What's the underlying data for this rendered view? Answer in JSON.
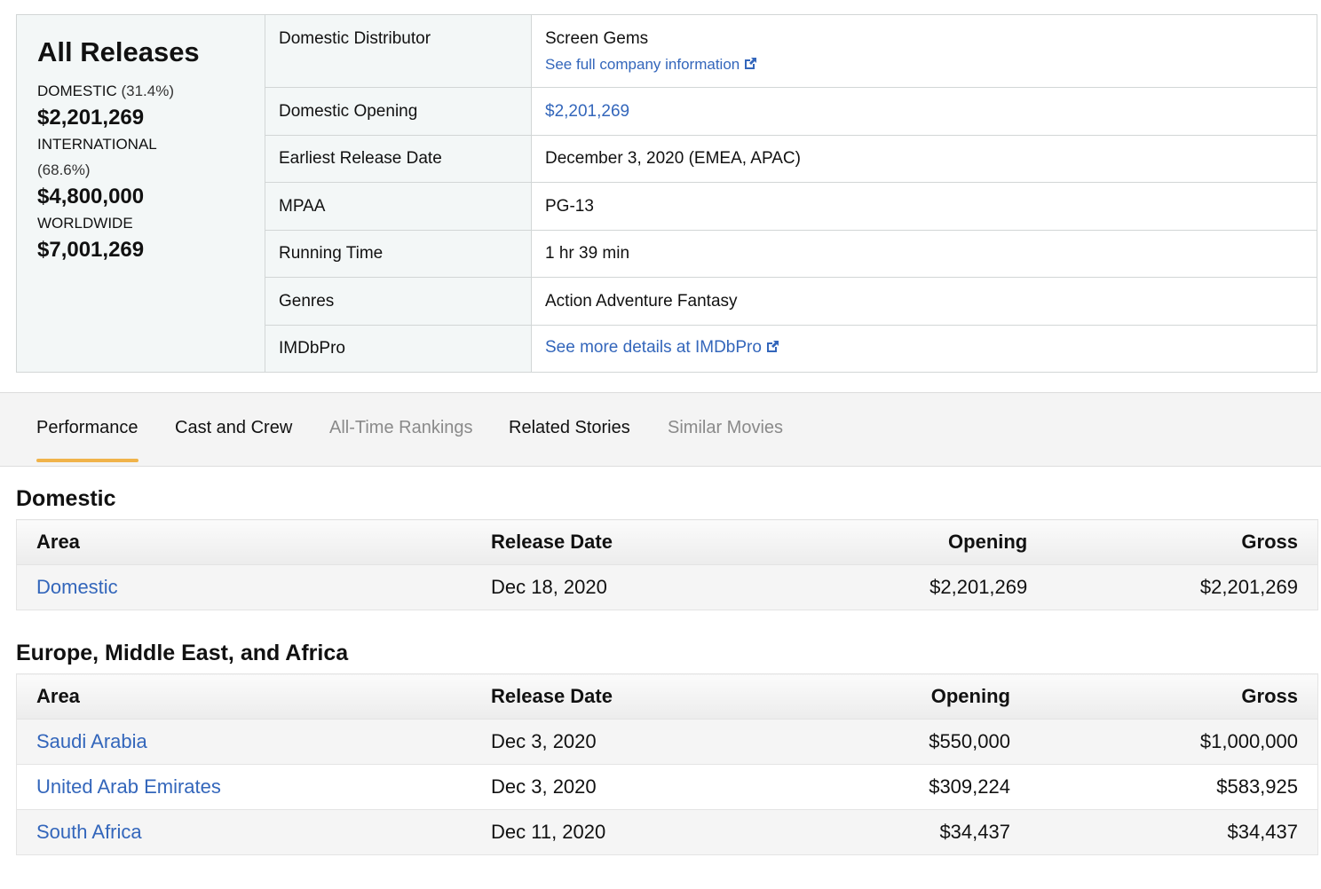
{
  "summary": {
    "title": "All Releases",
    "domestic_label": "DOMESTIC",
    "domestic_pct": "(31.4%)",
    "domestic_amount": "$2,201,269",
    "international_label": "INTERNATIONAL",
    "international_pct": "(68.6%)",
    "international_amount": "$4,800,000",
    "worldwide_label": "WORLDWIDE",
    "worldwide_amount": "$7,001,269"
  },
  "details": {
    "distributor_label": "Domestic Distributor",
    "distributor_value": "Screen Gems",
    "distributor_link": "See full company information",
    "opening_label": "Domestic Opening",
    "opening_value": "$2,201,269",
    "release_label": "Earliest Release Date",
    "release_value": "December 3, 2020 (EMEA, APAC)",
    "mpaa_label": "MPAA",
    "mpaa_value": "PG-13",
    "runtime_label": "Running Time",
    "runtime_value": "1 hr 39 min",
    "genres_label": "Genres",
    "genres_value": "Action Adventure Fantasy",
    "imdbpro_label": "IMDbPro",
    "imdbpro_link": "See more details at IMDbPro"
  },
  "tabs": [
    {
      "label": "Performance",
      "state": "active"
    },
    {
      "label": "Cast and Crew",
      "state": "enabled"
    },
    {
      "label": "All-Time Rankings",
      "state": "disabled"
    },
    {
      "label": "Related Stories",
      "state": "enabled"
    },
    {
      "label": "Similar Movies",
      "state": "disabled"
    }
  ],
  "domestic": {
    "title": "Domestic",
    "headers": {
      "area": "Area",
      "date": "Release Date",
      "opening": "Opening",
      "gross": "Gross"
    },
    "rows": [
      {
        "area": "Domestic",
        "date": "Dec 18, 2020",
        "opening": "$2,201,269",
        "gross": "$2,201,269"
      }
    ]
  },
  "emea": {
    "title": "Europe, Middle East, and Africa",
    "headers": {
      "area": "Area",
      "date": "Release Date",
      "opening": "Opening",
      "gross": "Gross"
    },
    "rows": [
      {
        "area": "Saudi Arabia",
        "date": "Dec 3, 2020",
        "opening": "$550,000",
        "gross": "$1,000,000"
      },
      {
        "area": "United Arab Emirates",
        "date": "Dec 3, 2020",
        "opening": "$309,224",
        "gross": "$583,925"
      },
      {
        "area": "South Africa",
        "date": "Dec 11, 2020",
        "opening": "$34,437",
        "gross": "$34,437"
      }
    ]
  },
  "colors": {
    "link": "#3366bb",
    "tab_underline": "#f0b34a",
    "panel_bg": "#f3f7f7"
  }
}
